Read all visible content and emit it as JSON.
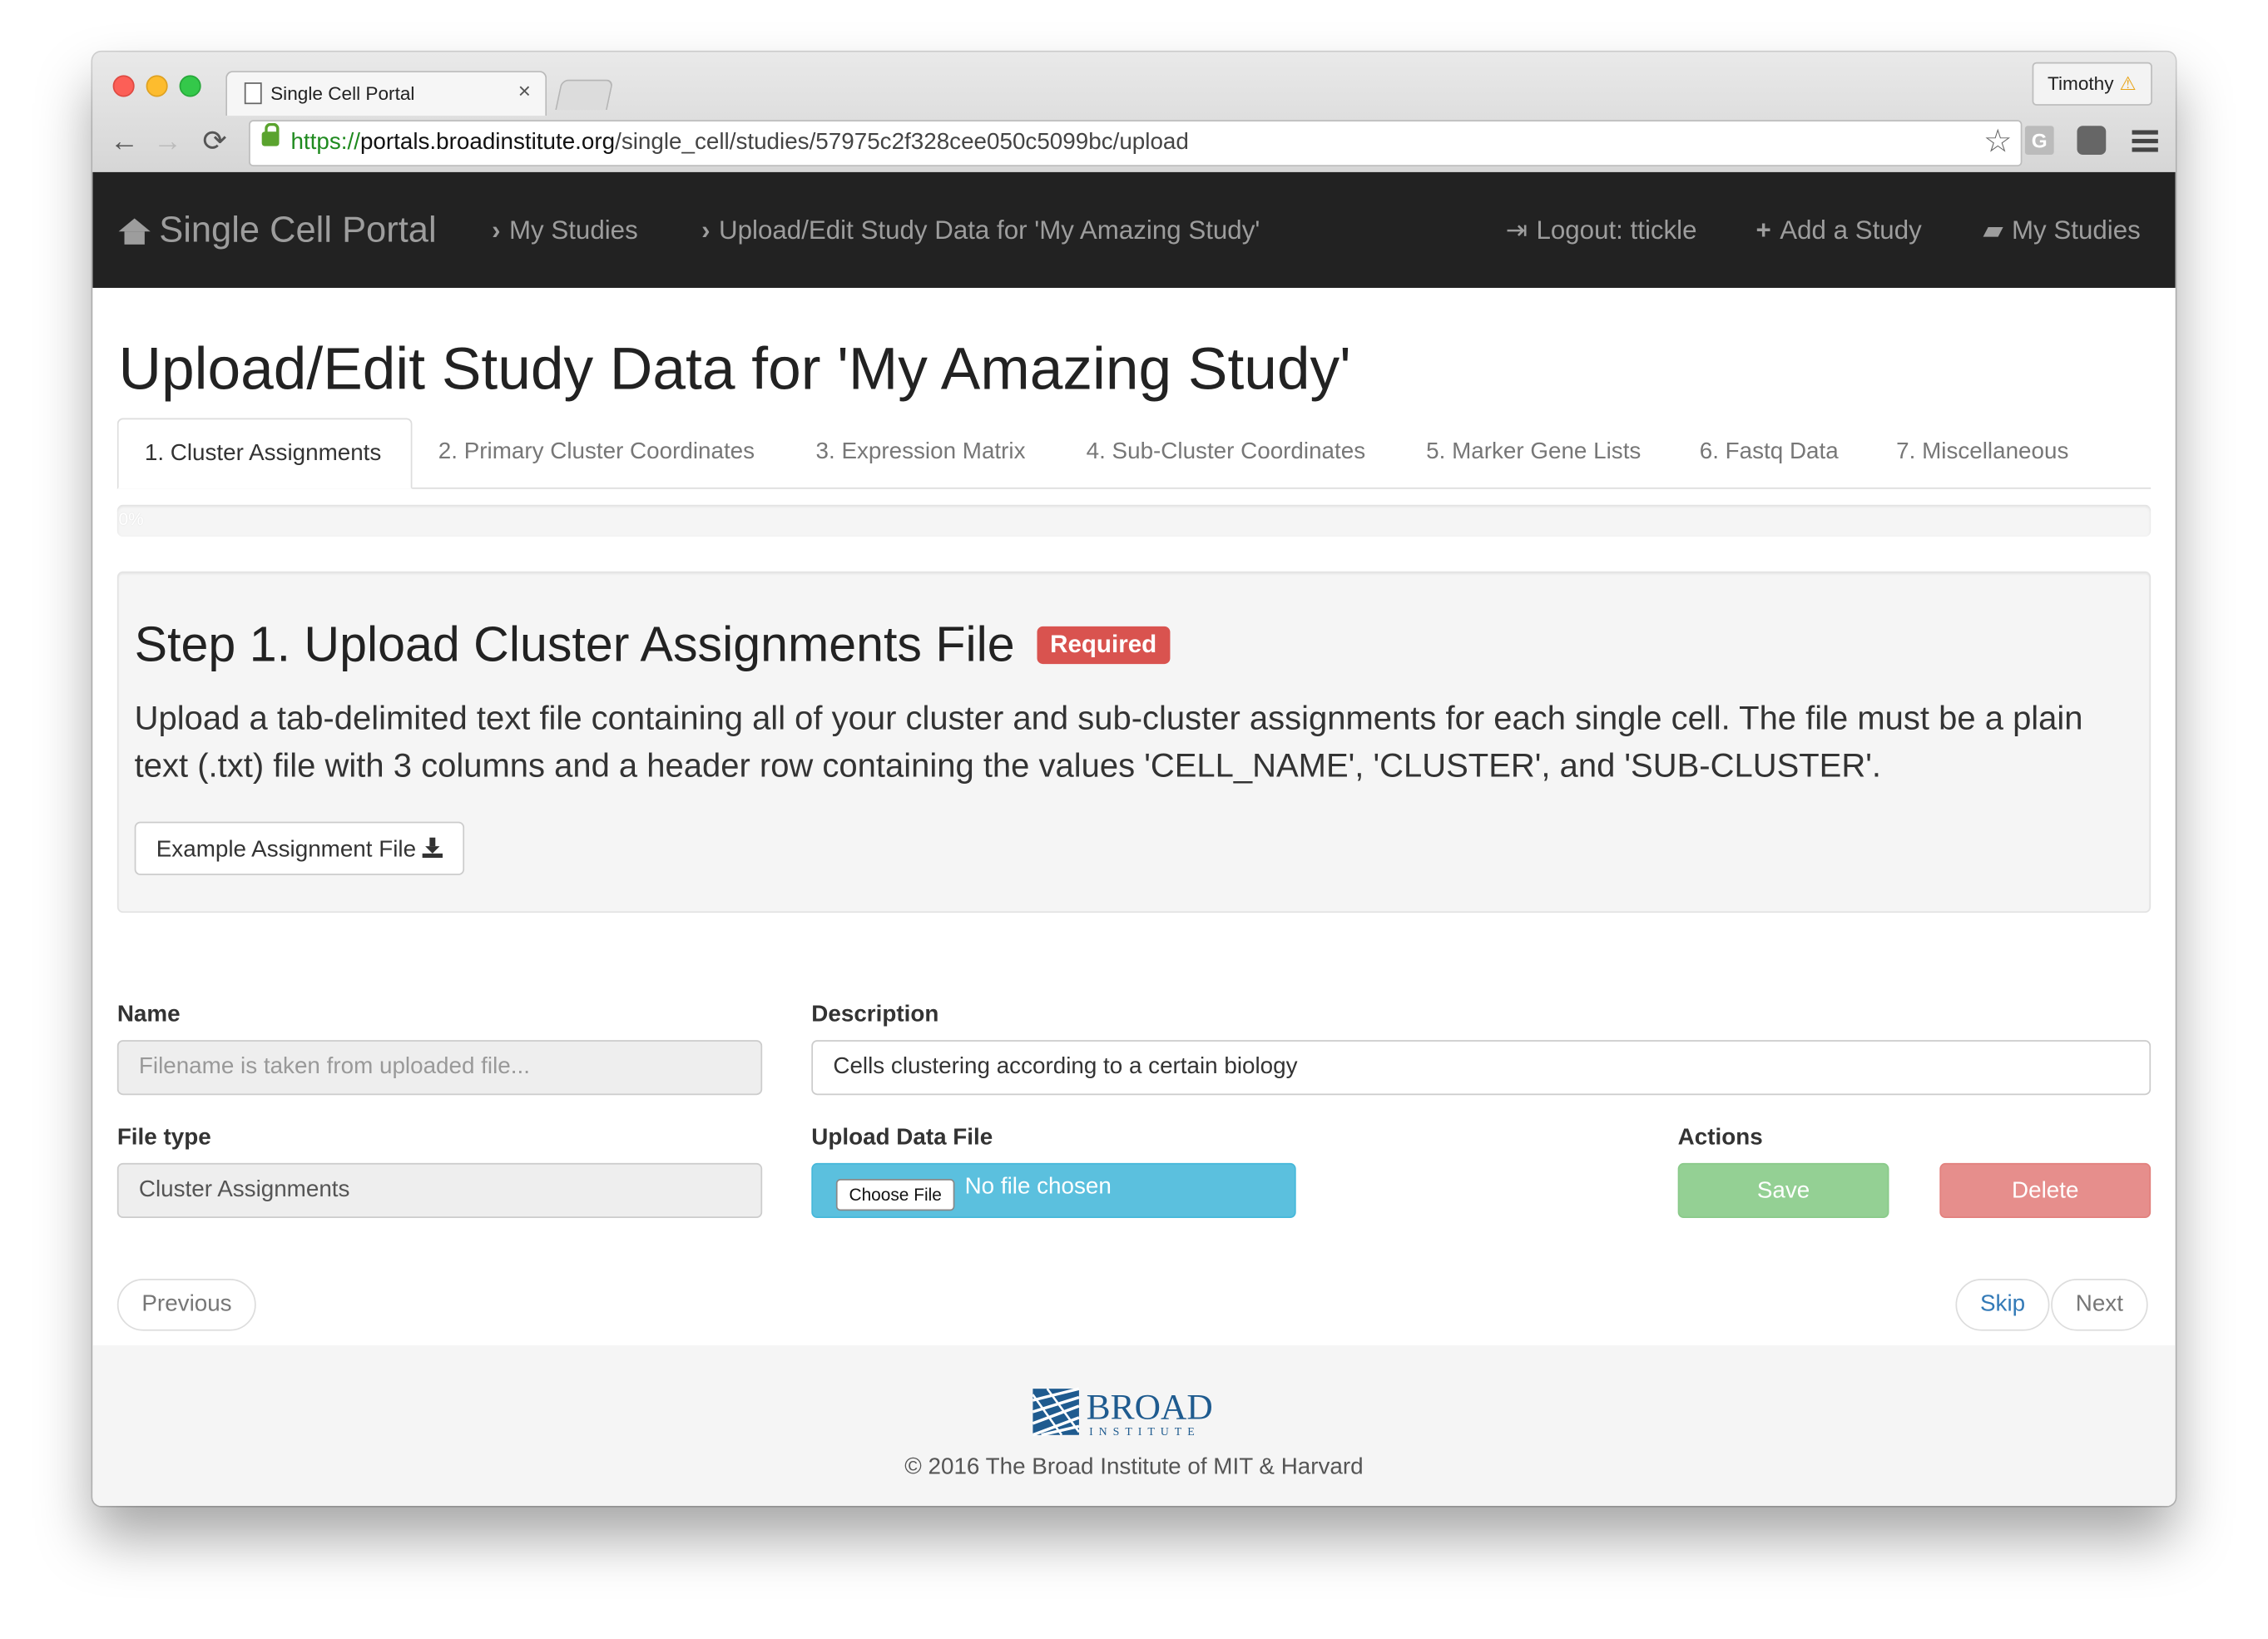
{
  "browser": {
    "tab_title": "Single Cell Portal",
    "tab_close": "×",
    "profile_name": "Timothy",
    "profile_warning": "⚠",
    "url_scheme": "https://",
    "url_host": "portals.broadinstitute.org",
    "url_path": "/single_cell/studies/57975c2f328cee050c5099bc/upload",
    "back": "←",
    "forward": "→",
    "reload": "⟳",
    "bookmark": "☆",
    "extension_g": "G"
  },
  "navbar": {
    "brand": "Single Cell Portal",
    "breadcrumbs": [
      "My Studies",
      "Upload/Edit Study Data for 'My Amazing Study'"
    ],
    "chevron": "›",
    "logout": "Logout: ttickle",
    "add_study": "Add a Study",
    "my_studies": "My Studies",
    "logout_icon": "⇥",
    "plus_icon": "+",
    "book_icon": "▰"
  },
  "page": {
    "title": "Upload/Edit Study Data for 'My Amazing Study'"
  },
  "tabs": [
    {
      "label": "1. Cluster Assignments",
      "active": true
    },
    {
      "label": "2. Primary Cluster Coordinates"
    },
    {
      "label": "3. Expression Matrix"
    },
    {
      "label": "4. Sub-Cluster Coordinates"
    },
    {
      "label": "5. Marker Gene Lists"
    },
    {
      "label": "6. Fastq Data"
    },
    {
      "label": "7. Miscellaneous"
    }
  ],
  "progress": {
    "label": "0%",
    "value": 0
  },
  "step": {
    "heading": "Step 1. Upload Cluster Assignments File",
    "badge": "Required",
    "description": "Upload a tab-delimited text file containing all of your cluster and sub-cluster assignments for each single cell. The file must be a plain text (.txt) file with 3 columns and a header row containing the values 'CELL_NAME', 'CLUSTER', and 'SUB-CLUSTER'.",
    "example_button": "Example Assignment File"
  },
  "form": {
    "name_label": "Name",
    "name_placeholder": "Filename is taken from uploaded file...",
    "description_label": "Description",
    "description_value": "Cells clustering according to a certain biology",
    "file_type_label": "File type",
    "file_type_value": "Cluster Assignments",
    "upload_label": "Upload Data File",
    "choose_file": "Choose File",
    "no_file": "No file chosen",
    "actions_label": "Actions",
    "save": "Save",
    "delete": "Delete"
  },
  "pager": {
    "previous": "Previous",
    "skip": "Skip",
    "next": "Next"
  },
  "footer": {
    "logo_word": "BROAD",
    "logo_sub": "INSTITUTE",
    "copyright": "© 2016 The Broad Institute of MIT & Harvard"
  },
  "colors": {
    "navbar_bg": "#222222",
    "required_badge": "#d9534f",
    "upload_button": "#5bc0de",
    "save_button": "#5cb85c",
    "delete_button": "#d9534f",
    "link": "#337ab7",
    "broad_blue": "#1f5b8f"
  }
}
